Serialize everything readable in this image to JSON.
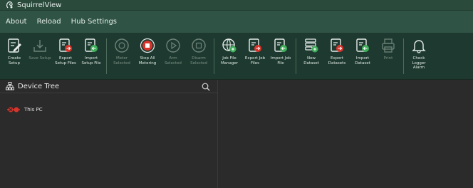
{
  "app": {
    "title": "SquirrelView"
  },
  "menu": {
    "items": [
      "About",
      "Reload",
      "Hub Settings"
    ]
  },
  "toolbar": {
    "group1": [
      {
        "label": "Create Setup",
        "icon": "create-setup-icon",
        "enabled": true
      },
      {
        "label": "Save Setup",
        "icon": "save-icon",
        "enabled": false
      },
      {
        "label": "Export Setup Files",
        "icon": "export-setup-icon",
        "enabled": true
      },
      {
        "label": "Import Setup File",
        "icon": "import-setup-icon",
        "enabled": true
      }
    ],
    "group2": [
      {
        "label": "Meter Selected",
        "icon": "meter-icon",
        "enabled": false
      },
      {
        "label": "Stop All Metering",
        "icon": "stop-icon",
        "enabled": true
      },
      {
        "label": "Arm Selected",
        "icon": "arm-icon",
        "enabled": false
      },
      {
        "label": "Disarm Selected",
        "icon": "disarm-icon",
        "enabled": false
      }
    ],
    "group3": [
      {
        "label": "Job File Manager",
        "icon": "job-file-manager-icon",
        "enabled": true
      },
      {
        "label": "Export Job Files",
        "icon": "export-job-icon",
        "enabled": true
      },
      {
        "label": "Import Job File",
        "icon": "import-job-icon",
        "enabled": true
      }
    ],
    "group4": [
      {
        "label": "New Dataset",
        "icon": "new-dataset-icon",
        "enabled": true
      },
      {
        "label": "Export Datasets",
        "icon": "export-datasets-icon",
        "enabled": true
      },
      {
        "label": "Import Dataset",
        "icon": "import-dataset-icon",
        "enabled": true
      },
      {
        "label": "Print",
        "icon": "print-icon",
        "enabled": false
      }
    ],
    "group5": [
      {
        "label": "Check Logger Alarm",
        "icon": "bell-icon",
        "enabled": true
      }
    ]
  },
  "device_tree": {
    "title": "Device Tree",
    "nodes": [
      {
        "label": "This PC"
      }
    ]
  },
  "colors": {
    "titlebar": "#2a4a3c",
    "menubar": "#2f5345",
    "toolbar": "#1e3a30",
    "accent_red": "#d9342b",
    "accent_green": "#3fae5a"
  }
}
